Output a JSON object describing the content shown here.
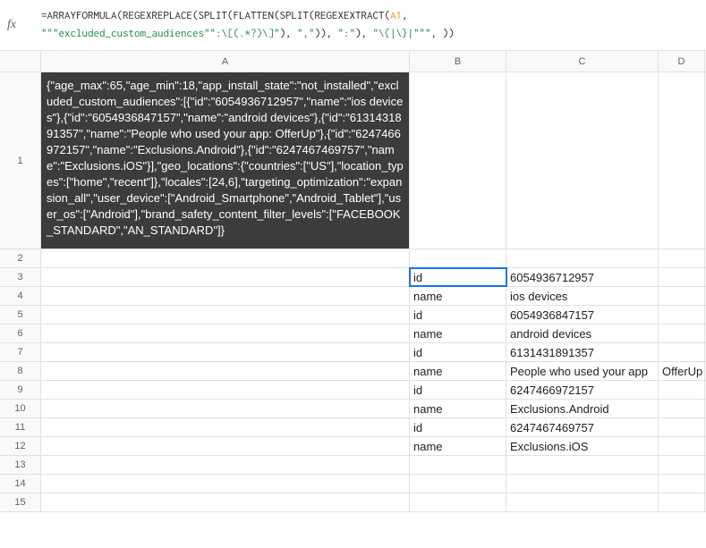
{
  "formula": {
    "prefix": "=ARRAYFORMULA(REGEXREPLACE(SPLIT(FLATTEN(SPLIT(REGEXEXTRACT(",
    "ref": "A1",
    "after_ref": ",",
    "str1": "\"\"\"excluded_custom_audiences\"\":\\[(.*?)\\]\"",
    "punct1": "), ",
    "str2": "\",\"",
    "punct2": ")), ",
    "str3": "\":\"",
    "punct3": "), ",
    "str4": "\"\\{|\\}|\"\"\"",
    "punct4": ", ))"
  },
  "fx_label": "fx",
  "columns": {
    "A": "A",
    "B": "B",
    "C": "C",
    "D": "D"
  },
  "a1_json": "{\"age_max\":65,\"age_min\":18,\"app_install_state\":\"not_installed\",\"excluded_custom_audiences\":[{\"id\":\"6054936712957\",\"name\":\"ios devices\"},{\"id\":\"6054936847157\",\"name\":\"android devices\"},{\"id\":\"6131431891357\",\"name\":\"People who used your app: OfferUp\"},{\"id\":\"6247466972157\",\"name\":\"Exclusions.Android\"},{\"id\":\"6247467469757\",\"name\":\"Exclusions.iOS\"}],\"geo_locations\":{\"countries\":[\"US\"],\"location_types\":[\"home\",\"recent\"]},\"locales\":[24,6],\"targeting_optimization\":\"expansion_all\",\"user_device\":[\"Android_Smartphone\",\"Android_Tablet\"],\"user_os\":[\"Android\"],\"brand_safety_content_filter_levels\":[\"FACEBOOK_STANDARD\",\"AN_STANDARD\"]}",
  "rows": [
    {
      "n": "1"
    },
    {
      "n": "2"
    },
    {
      "n": "3",
      "B": "id",
      "C": "6054936712957"
    },
    {
      "n": "4",
      "B": "name",
      "C": "ios devices"
    },
    {
      "n": "5",
      "B": "id",
      "C": "6054936847157"
    },
    {
      "n": "6",
      "B": "name",
      "C": "android devices"
    },
    {
      "n": "7",
      "B": "id",
      "C": "6131431891357"
    },
    {
      "n": "8",
      "B": "name",
      "C": "People who used your app",
      "D": "OfferUp"
    },
    {
      "n": "9",
      "B": "id",
      "C": "6247466972157"
    },
    {
      "n": "10",
      "B": "name",
      "C": "Exclusions.Android"
    },
    {
      "n": "11",
      "B": "id",
      "C": "6247467469757"
    },
    {
      "n": "12",
      "B": "name",
      "C": "Exclusions.iOS"
    },
    {
      "n": "13"
    },
    {
      "n": "14"
    },
    {
      "n": "15"
    }
  ]
}
